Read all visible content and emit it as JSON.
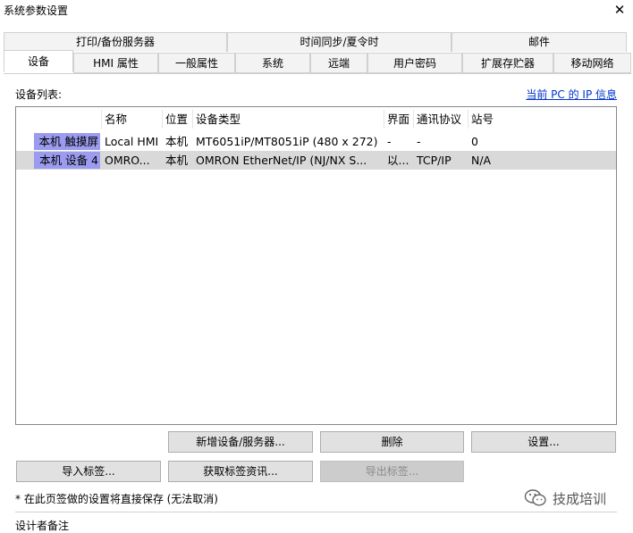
{
  "window": {
    "title": "系统参数设置",
    "close_glyph": "✕"
  },
  "tabs_back": [
    "打印/备份服务器",
    "时间同步/夏令时",
    "邮件"
  ],
  "tabs_front": [
    "设备",
    "HMI 属性",
    "一般属性",
    "系统",
    "远端",
    "用户密码",
    "扩展存贮器",
    "移动网络"
  ],
  "active_tab": "设备",
  "device_list": {
    "label": "设备列表:",
    "pc_ip_link": "当前 PC 的 IP 信息",
    "columns": [
      "名称",
      "位置",
      "设备类型",
      "界面",
      "通讯协议",
      "站号"
    ],
    "rows": [
      {
        "row_header": "本机 触摸屏",
        "cells": [
          "Local HMI",
          "本机",
          "MT6051iP/MT8051iP (480 x 272)",
          "-",
          "-",
          "0"
        ],
        "selected": false
      },
      {
        "row_header": "本机 设备 4",
        "cells": [
          "OMRO...",
          "本机",
          "OMRON EtherNet/IP (NJ/NX S...",
          "以...",
          "TCP/IP",
          "N/A"
        ],
        "selected": true
      }
    ]
  },
  "buttons": {
    "new_device": "新增设备/服务器...",
    "delete": "删除",
    "settings": "设置...",
    "import_tags": "导入标签...",
    "get_tag_info": "获取标签资讯...",
    "export_tags": "导出标签..."
  },
  "note": "* 在此页签做的设置将直接保存 (无法取消)",
  "bottom_partial": "设计者备注",
  "watermark": "技成培训"
}
